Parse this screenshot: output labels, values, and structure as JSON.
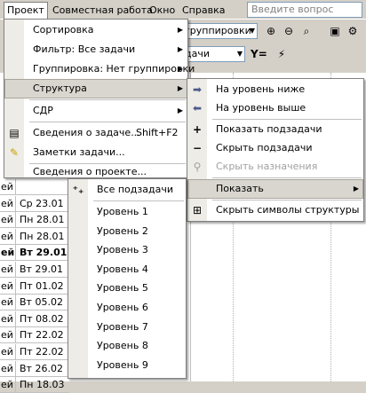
{
  "menubar": {
    "items": [
      "Проект",
      "Совместная работа",
      "Окно",
      "Справка"
    ],
    "help_placeholder": "Введите вопрос"
  },
  "toolbar": {
    "group_combo": "группировки",
    "filter_combo": "дачи"
  },
  "grid_rows": [
    {
      "c1": "ей",
      "c2": "",
      "bold": false
    },
    {
      "c1": "ей",
      "c2": "Ср 23.01",
      "bold": false
    },
    {
      "c1": "ей",
      "c2": "Пн 28.01",
      "bold": false
    },
    {
      "c1": "ей",
      "c2": "Пн 28.01",
      "bold": false
    },
    {
      "c1": "ей",
      "c2": "Вт 29.01",
      "bold": true
    },
    {
      "c1": "ей",
      "c2": "Вт 29.01",
      "bold": false
    },
    {
      "c1": "ей",
      "c2": "Пт 01.02",
      "bold": false
    },
    {
      "c1": "ей",
      "c2": "Вт 05.02",
      "bold": false
    },
    {
      "c1": "ей",
      "c2": "Пт 08.02",
      "bold": false
    },
    {
      "c1": "ей",
      "c2": "Пт 22.02",
      "bold": false
    },
    {
      "c1": "ей",
      "c2": "Пт 22.02",
      "bold": false
    },
    {
      "c1": "ей",
      "c2": "Вт 26.02",
      "bold": false
    },
    {
      "c1": "ей",
      "c2": "Пн 18.03",
      "bold": false
    }
  ],
  "project_menu": {
    "items": [
      {
        "label": "Сортировка",
        "submenu": true
      },
      {
        "label": "Фильтр: Все задачи",
        "submenu": true
      },
      {
        "label": "Группировка: Нет группировки",
        "submenu": true
      },
      {
        "label": "Структура",
        "submenu": true
      },
      {
        "label": "СДР",
        "submenu": true
      },
      {
        "label": "Сведения о задаче...",
        "shortcut": "Shift+F2"
      },
      {
        "label": "Заметки задачи..."
      },
      {
        "label": "Сведения о проекте..."
      }
    ]
  },
  "structure_menu": {
    "items": [
      {
        "label": "На уровень ниже",
        "icon": "arrow-right-icon"
      },
      {
        "label": "На уровень выше",
        "icon": "arrow-left-icon"
      },
      {
        "label": "Показать подзадачи",
        "icon": "plus-icon"
      },
      {
        "label": "Скрыть подзадачи",
        "icon": "minus-icon"
      },
      {
        "label": "Скрыть назначения",
        "icon": "hide-assignments-icon"
      },
      {
        "label": "Показать"
      },
      {
        "label": "Скрыть символы структуры",
        "icon": "outline-symbols-icon"
      }
    ]
  },
  "show_menu": {
    "items": [
      "Все подзадачи",
      "Уровень 1",
      "Уровень 2",
      "Уровень 3",
      "Уровень 4",
      "Уровень 5",
      "Уровень 6",
      "Уровень 7",
      "Уровень 8",
      "Уровень 9"
    ]
  },
  "colors": {
    "menu_bg": "#ffffff",
    "highlight": "#d9d6cf",
    "chrome": "#d4d0c8"
  }
}
